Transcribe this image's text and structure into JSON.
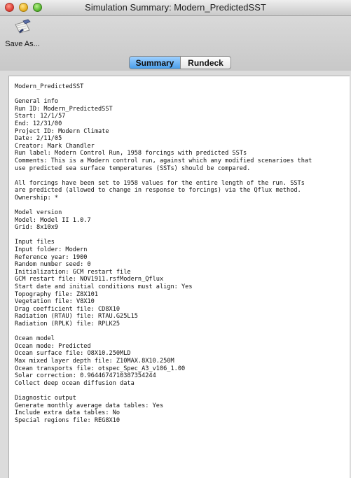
{
  "window": {
    "title": "Simulation Summary: Modern_PredictedSST"
  },
  "toolbar": {
    "save_label": "Save As..."
  },
  "tabs": [
    {
      "label": "Summary",
      "active": true
    },
    {
      "label": "Rundeck",
      "active": false
    }
  ],
  "summary_lines": [
    "Modern_PredictedSST",
    "",
    "General info",
    "Run ID: Modern_PredictedSST",
    "Start: 12/1/57",
    "End: 12/31/00",
    "Project ID: Modern Climate",
    "Date: 2/11/05",
    "Creator: Mark Chandler",
    "Run label: Modern Control Run, 1958 forcings with predicted SSTs",
    "Comments: This is a Modern control run, against which any modified scenarioes that",
    "use predicted sea surface temperatures (SSTs) should be compared.",
    "",
    "All forcings have been set to 1958 values for the entire length of the run. SSTs",
    "are predicted (allowed to change in response to forcings) via the Qflux method.",
    "Ownership: *",
    "",
    "Model version",
    "Model: Model II 1.0.7",
    "Grid: 8x10x9",
    "",
    "Input files",
    "Input folder: Modern",
    "Reference year: 1900",
    "Random number seed: 0",
    "Initialization: GCM restart file",
    "GCM restart file: NOV1911.rsfModern_Qflux",
    "Start date and initial conditions must align: Yes",
    "Topography file: Z8X101",
    "Vegetation file: V8X10",
    "Drag coefficient file: CD8X10",
    "Radiation (RTAU) file: RTAU.G25L15",
    "Radiation (RPLK) file: RPLK25",
    "",
    "Ocean model",
    "Ocean mode: Predicted",
    "Ocean surface file: O8X10.250MLD",
    "Max mixed layer depth file: Z10MAX.8X10.250M",
    "Ocean transports file: otspec_Spec_A3_v106_1.00",
    "Solar correction: 0.9644674710387354244",
    "Collect deep ocean diffusion data",
    "",
    "Diagnostic output",
    "Generate monthly average data tables: Yes",
    "Include extra data tables: No",
    "Special regions file: REG8X10"
  ]
}
